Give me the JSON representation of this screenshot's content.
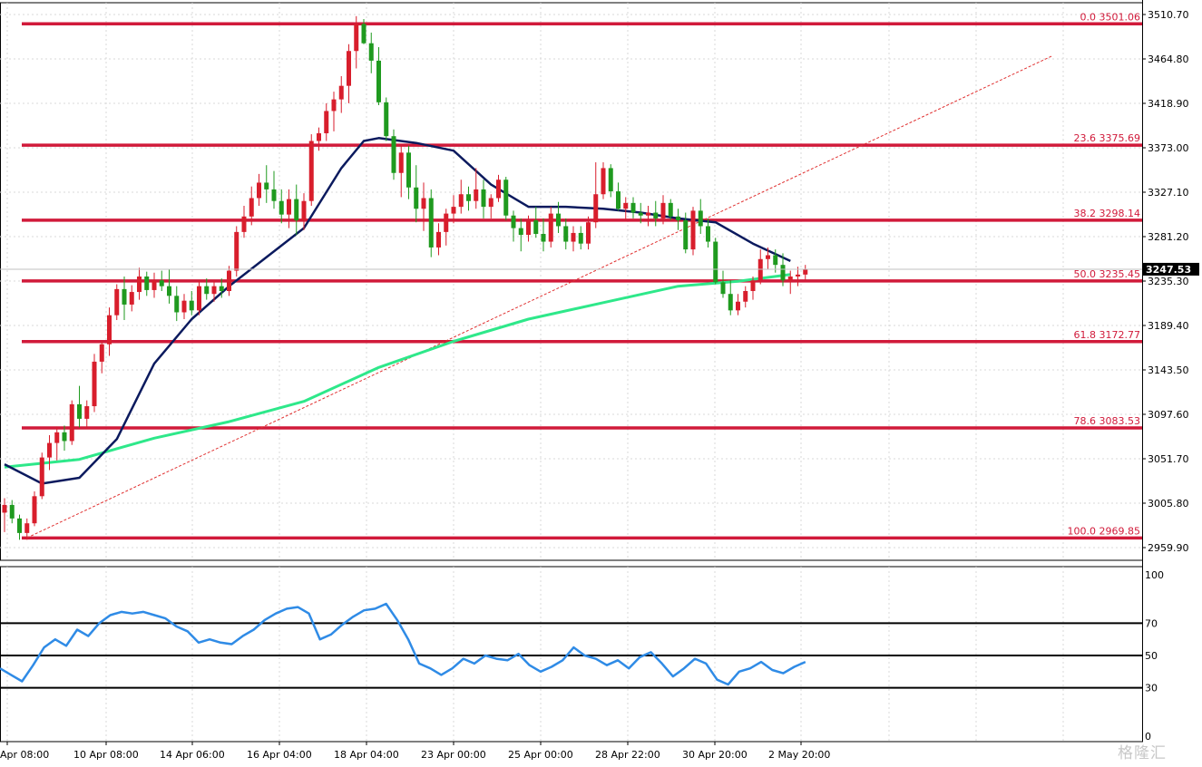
{
  "chart_data": {
    "type": "candlestick",
    "y_axis_ticks": [
      "3510.70",
      "3464.80",
      "3418.90",
      "3373.00",
      "3327.10",
      "3281.20",
      "3235.30",
      "3189.40",
      "3143.50",
      "3097.60",
      "3051.70",
      "3005.80",
      "2959.90"
    ],
    "ylim": [
      2940.3,
      3521.5
    ],
    "x_axis_ticks": [
      "Apr 08:00",
      "10 Apr 08:00",
      "14 Apr 06:00",
      "16 Apr 04:00",
      "18 Apr 04:00",
      "23 Apr 00:00",
      "25 Apr 00:00",
      "28 Apr 22:00",
      "30 Apr 20:00",
      "2 May 20:00"
    ],
    "current_price": 3247.53,
    "current_price_label": "3247.53",
    "colors": {
      "up": "#d81e2c",
      "down": "#1f9a1f",
      "fib": "#d11a3a",
      "ma_fast": "#0b1a5e",
      "ma_slow": "#2ee88a",
      "trend": "#e03030",
      "rsi": "#2f8be6"
    },
    "fibonacci": [
      {
        "ratio_label": "0.0 3501.06",
        "price": 3501.06
      },
      {
        "ratio_label": "23.6 3375.69",
        "price": 3375.69
      },
      {
        "ratio_label": "38.2 3298.14",
        "price": 3298.14
      },
      {
        "ratio_label": "50.0 3235.45",
        "price": 3235.45
      },
      {
        "ratio_label": "61.8 3172.77",
        "price": 3172.77
      },
      {
        "ratio_label": "78.6 3083.53",
        "price": 3083.53
      },
      {
        "ratio_label": "100.0 2969.85",
        "price": 2969.85
      }
    ],
    "candles": [
      [
        2996,
        3011,
        2976,
        3004
      ],
      [
        3004,
        3009,
        2985,
        2990
      ],
      [
        2990,
        2994,
        2968,
        2975
      ],
      [
        2975,
        2990,
        2968,
        2985
      ],
      [
        2985,
        3018,
        2982,
        3013
      ],
      [
        3013,
        3058,
        3010,
        3053
      ],
      [
        3053,
        3076,
        3040,
        3068
      ],
      [
        3068,
        3085,
        3050,
        3079
      ],
      [
        3079,
        3086,
        3060,
        3070
      ],
      [
        3070,
        3112,
        3066,
        3108
      ],
      [
        3108,
        3127,
        3084,
        3093
      ],
      [
        3093,
        3112,
        3083,
        3106
      ],
      [
        3106,
        3160,
        3100,
        3152
      ],
      [
        3152,
        3174,
        3140,
        3170
      ],
      [
        3170,
        3208,
        3158,
        3200
      ],
      [
        3200,
        3232,
        3195,
        3227
      ],
      [
        3227,
        3240,
        3195,
        3211
      ],
      [
        3211,
        3231,
        3204,
        3224
      ],
      [
        3224,
        3249,
        3216,
        3240
      ],
      [
        3240,
        3245,
        3220,
        3226
      ],
      [
        3226,
        3244,
        3218,
        3236
      ],
      [
        3236,
        3246,
        3225,
        3230
      ],
      [
        3230,
        3247,
        3212,
        3220
      ],
      [
        3220,
        3230,
        3194,
        3203
      ],
      [
        3203,
        3222,
        3196,
        3215
      ],
      [
        3215,
        3225,
        3200,
        3205
      ],
      [
        3205,
        3236,
        3200,
        3230
      ],
      [
        3230,
        3238,
        3216,
        3222
      ],
      [
        3222,
        3236,
        3214,
        3230
      ],
      [
        3230,
        3238,
        3218,
        3225
      ],
      [
        3225,
        3251,
        3220,
        3246
      ],
      [
        3246,
        3292,
        3240,
        3286
      ],
      [
        3286,
        3313,
        3280,
        3302
      ],
      [
        3302,
        3333,
        3293,
        3321
      ],
      [
        3321,
        3346,
        3313,
        3337
      ],
      [
        3337,
        3355,
        3316,
        3330
      ],
      [
        3330,
        3349,
        3310,
        3318
      ],
      [
        3318,
        3330,
        3295,
        3304
      ],
      [
        3304,
        3330,
        3290,
        3320
      ],
      [
        3320,
        3335,
        3283,
        3298
      ],
      [
        3298,
        3326,
        3288,
        3318
      ],
      [
        3318,
        3387,
        3313,
        3380
      ],
      [
        3380,
        3394,
        3370,
        3388
      ],
      [
        3388,
        3419,
        3380,
        3411
      ],
      [
        3411,
        3431,
        3390,
        3423
      ],
      [
        3423,
        3447,
        3409,
        3437
      ],
      [
        3437,
        3480,
        3419,
        3473
      ],
      [
        3473,
        3509,
        3455,
        3501
      ],
      [
        3501,
        3506,
        3480,
        3481
      ],
      [
        3481,
        3492,
        3450,
        3463
      ],
      [
        3463,
        3477,
        3417,
        3420
      ],
      [
        3420,
        3425,
        3380,
        3385
      ],
      [
        3385,
        3392,
        3340,
        3347
      ],
      [
        3347,
        3376,
        3322,
        3368
      ],
      [
        3368,
        3375,
        3320,
        3332
      ],
      [
        3332,
        3355,
        3296,
        3310
      ],
      [
        3310,
        3337,
        3287,
        3321
      ],
      [
        3321,
        3330,
        3260,
        3270
      ],
      [
        3270,
        3295,
        3262,
        3286
      ],
      [
        3286,
        3310,
        3272,
        3305
      ],
      [
        3305,
        3324,
        3295,
        3312
      ],
      [
        3312,
        3340,
        3305,
        3325
      ],
      [
        3325,
        3333,
        3308,
        3318
      ],
      [
        3318,
        3352,
        3310,
        3330
      ],
      [
        3330,
        3340,
        3300,
        3312
      ],
      [
        3312,
        3325,
        3300,
        3321
      ],
      [
        3321,
        3345,
        3317,
        3340
      ],
      [
        3340,
        3343,
        3298,
        3303
      ],
      [
        3303,
        3308,
        3276,
        3290
      ],
      [
        3290,
        3300,
        3266,
        3283
      ],
      [
        3283,
        3303,
        3276,
        3298
      ],
      [
        3298,
        3312,
        3280,
        3284
      ],
      [
        3284,
        3300,
        3266,
        3276
      ],
      [
        3276,
        3312,
        3270,
        3305
      ],
      [
        3305,
        3317,
        3285,
        3292
      ],
      [
        3292,
        3300,
        3268,
        3276
      ],
      [
        3276,
        3292,
        3266,
        3285
      ],
      [
        3285,
        3292,
        3268,
        3274
      ],
      [
        3274,
        3302,
        3268,
        3296
      ],
      [
        3296,
        3358,
        3290,
        3325
      ],
      [
        3325,
        3358,
        3320,
        3352
      ],
      [
        3352,
        3356,
        3322,
        3328
      ],
      [
        3328,
        3337,
        3308,
        3310
      ],
      [
        3310,
        3322,
        3298,
        3316
      ],
      [
        3316,
        3322,
        3300,
        3306
      ],
      [
        3306,
        3316,
        3295,
        3303
      ],
      [
        3303,
        3313,
        3292,
        3306
      ],
      [
        3306,
        3318,
        3292,
        3300
      ],
      [
        3300,
        3324,
        3294,
        3316
      ],
      [
        3316,
        3320,
        3298,
        3302
      ],
      [
        3302,
        3310,
        3288,
        3298
      ],
      [
        3298,
        3306,
        3264,
        3268
      ],
      [
        3268,
        3312,
        3262,
        3308
      ],
      [
        3308,
        3320,
        3284,
        3292
      ],
      [
        3292,
        3300,
        3270,
        3276
      ],
      [
        3276,
        3280,
        3232,
        3234
      ],
      [
        3234,
        3246,
        3218,
        3222
      ],
      [
        3222,
        3236,
        3200,
        3205
      ],
      [
        3205,
        3222,
        3200,
        3214
      ],
      [
        3214,
        3230,
        3208,
        3225
      ],
      [
        3225,
        3240,
        3216,
        3236
      ],
      [
        3236,
        3268,
        3232,
        3258
      ],
      [
        3258,
        3270,
        3248,
        3262
      ],
      [
        3262,
        3268,
        3244,
        3252
      ],
      [
        3252,
        3264,
        3230,
        3236
      ],
      [
        3236,
        3246,
        3222,
        3240
      ],
      [
        3240,
        3250,
        3230,
        3242
      ],
      [
        3242,
        3252,
        3236,
        3247.53
      ]
    ],
    "ma_fast": [
      [
        0,
        3046
      ],
      [
        5,
        3026
      ],
      [
        10,
        3032
      ],
      [
        15,
        3072
      ],
      [
        20,
        3150
      ],
      [
        25,
        3196
      ],
      [
        30,
        3230
      ],
      [
        35,
        3260
      ],
      [
        40,
        3290
      ],
      [
        45,
        3352
      ],
      [
        48,
        3380
      ],
      [
        50,
        3383
      ],
      [
        55,
        3378
      ],
      [
        60,
        3370
      ],
      [
        65,
        3335
      ],
      [
        70,
        3312
      ],
      [
        75,
        3312
      ],
      [
        80,
        3310
      ],
      [
        85,
        3306
      ],
      [
        90,
        3300
      ],
      [
        95,
        3296
      ],
      [
        100,
        3274
      ],
      [
        105,
        3256
      ]
    ],
    "ma_slow": [
      [
        0,
        3043
      ],
      [
        10,
        3051
      ],
      [
        20,
        3073
      ],
      [
        30,
        3090
      ],
      [
        40,
        3111
      ],
      [
        50,
        3146
      ],
      [
        60,
        3173
      ],
      [
        70,
        3196
      ],
      [
        80,
        3213
      ],
      [
        90,
        3230
      ],
      [
        98,
        3235
      ],
      [
        105,
        3242
      ]
    ],
    "trendline": {
      "from": [
        3,
        2970
      ],
      "to": [
        140,
        3468
      ]
    },
    "rsi": {
      "ticks": [
        "100",
        "70",
        "50",
        "30",
        "0"
      ],
      "levels": [
        70,
        50,
        30
      ],
      "values": [
        42,
        38,
        34,
        44,
        55,
        60,
        56,
        66,
        62,
        70,
        75,
        77,
        76,
        77,
        75,
        73,
        68,
        65,
        58,
        60,
        58,
        57,
        62,
        66,
        72,
        76,
        79,
        80,
        76,
        60,
        63,
        69,
        74,
        78,
        79,
        82,
        72,
        60,
        45,
        42,
        38,
        42,
        48,
        45,
        50,
        48,
        47,
        51,
        44,
        40,
        43,
        47,
        55,
        50,
        48,
        44,
        47,
        42,
        49,
        52,
        45,
        37,
        42,
        48,
        45,
        35,
        32,
        40,
        42,
        46,
        41,
        39,
        43,
        46
      ]
    }
  }
}
